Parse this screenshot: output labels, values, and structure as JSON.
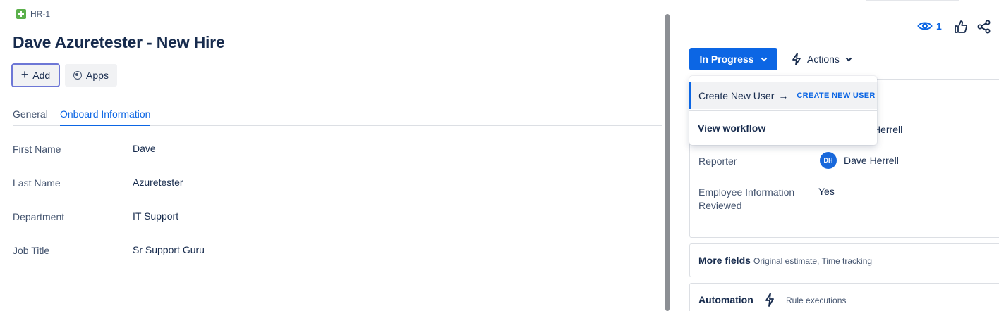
{
  "breadcrumb": {
    "issue_key": "HR-1"
  },
  "issue": {
    "title": "Dave Azuretester - New Hire"
  },
  "toolbar": {
    "add_label": "Add",
    "apps_label": "Apps"
  },
  "tabs": [
    {
      "label": "General",
      "active": false
    },
    {
      "label": "Onboard Information",
      "active": true
    }
  ],
  "fields": [
    {
      "label": "First Name",
      "value": "Dave"
    },
    {
      "label": "Last Name",
      "value": "Azuretester"
    },
    {
      "label": "Department",
      "value": "IT Support"
    },
    {
      "label": "Job Title",
      "value": "Sr Support Guru"
    }
  ],
  "header_actions": {
    "watchers_count": "1",
    "icons": [
      "eye-icon",
      "thumbs-up-icon",
      "share-icon"
    ]
  },
  "status": {
    "label": "In Progress",
    "color": "#0c66e4"
  },
  "actions": {
    "label": "Actions"
  },
  "dropdown": {
    "item1_label": "Create New User",
    "item1_arrow": "→",
    "item1_lozenge": "CREATE NEW USER",
    "item2_label": "View workflow"
  },
  "details": {
    "assignee_value_partial": "Herrell",
    "reporter_label": "Reporter",
    "reporter_initials": "DH",
    "reporter_name": "Dave Herrell",
    "reviewed_label_line1": "Employee Information",
    "reviewed_label_line2": "Reviewed",
    "reviewed_value": "Yes"
  },
  "more_fields": {
    "title": "More fields",
    "subtitle": "Original estimate, Time tracking"
  },
  "automation": {
    "title": "Automation",
    "subtitle": "Rule executions"
  }
}
